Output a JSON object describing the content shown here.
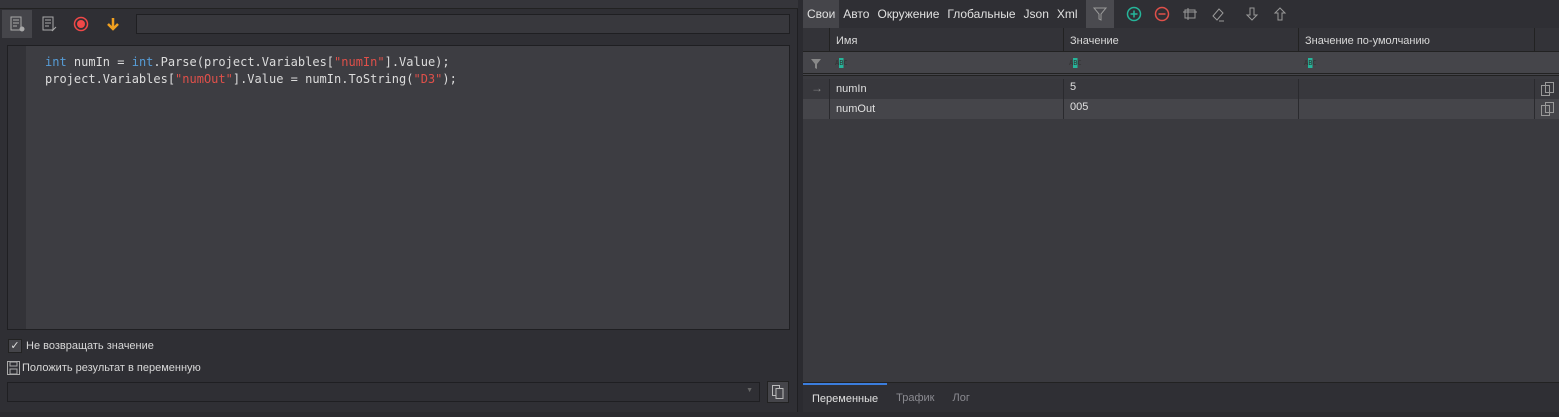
{
  "editor": {
    "code_lines": [
      [
        {
          "t": "int",
          "c": "kw"
        },
        {
          "t": " numIn = "
        },
        {
          "t": "int",
          "c": "kw"
        },
        {
          "t": ".Parse(project.Variables["
        },
        {
          "t": "\"numIn\"",
          "c": "str"
        },
        {
          "t": "].Value);"
        }
      ],
      [
        {
          "t": "project.Variables["
        },
        {
          "t": "\"numOut\"",
          "c": "str"
        },
        {
          "t": "].Value = numIn.ToString("
        },
        {
          "t": "\"D3\"",
          "c": "str"
        },
        {
          "t": ");"
        }
      ]
    ]
  },
  "options": {
    "no_return_label": "Не возвращать значение",
    "no_return_checked": true,
    "save_result_label": "Положить результат в переменную"
  },
  "right": {
    "tabs": [
      "Свои",
      "Авто",
      "Окружение",
      "Глобальные",
      "Json",
      "Xml"
    ],
    "columns": [
      "Имя",
      "Значение",
      "Значение по-умолчанию"
    ],
    "filter_glyph": "ABC",
    "rows": [
      {
        "name": "numIn",
        "value": "5",
        "default": ""
      },
      {
        "name": "numOut",
        "value": "005",
        "default": ""
      }
    ],
    "bottom_tabs": [
      "Переменные",
      "Трафик",
      "Лог"
    ]
  },
  "colors": {
    "accent": "#3b7ddd",
    "add": "#26b59a",
    "remove": "#e0504a",
    "record": "#f04848",
    "arrow": "#f0a020"
  }
}
